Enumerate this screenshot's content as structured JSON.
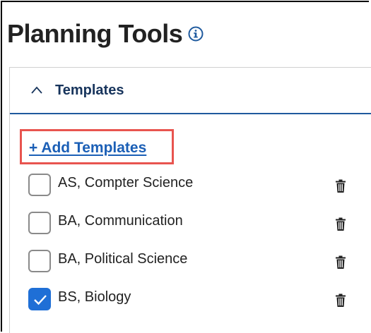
{
  "page": {
    "title": "Planning Tools",
    "info_icon": "info-icon"
  },
  "panel": {
    "title": "Templates",
    "expanded": true,
    "toggle_icon": "chevron-up-icon",
    "add_link": "+ Add Templates",
    "add_link_highlight_color": "#e8544f"
  },
  "templates": [
    {
      "label": "AS, Compter Science",
      "checked": false,
      "delete_icon": "trash-icon"
    },
    {
      "label": "BA, Communication",
      "checked": false,
      "delete_icon": "trash-icon"
    },
    {
      "label": "BA, Political Science",
      "checked": false,
      "delete_icon": "trash-icon"
    },
    {
      "label": "BS, Biology",
      "checked": true,
      "delete_icon": "trash-icon"
    }
  ],
  "colors": {
    "accent": "#1f5a9e",
    "link": "#1b5fb6",
    "checkbox_checked": "#1f6fd6",
    "highlight": "#e8544f"
  }
}
